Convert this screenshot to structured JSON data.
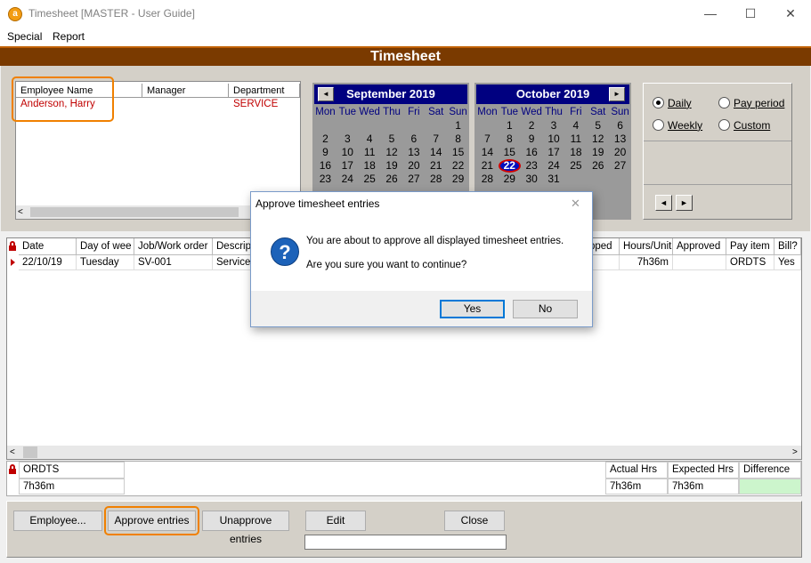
{
  "window": {
    "title": "Timesheet [MASTER - User Guide]",
    "app_icon_letter": "a",
    "minimize": "—",
    "maximize": "☐",
    "close": "✕"
  },
  "menu": [
    "Special",
    "Report"
  ],
  "banner_title": "Timesheet",
  "employee_list": {
    "columns": [
      "Employee Name",
      "Manager",
      "Department"
    ],
    "rows": [
      {
        "name": "Anderson, Harry",
        "manager": "",
        "department": "SERVICE"
      }
    ]
  },
  "calendars": [
    {
      "title": "September 2019",
      "nav": "◄",
      "weekdays": [
        "Mon",
        "Tue",
        "Wed",
        "Thu",
        "Fri",
        "Sat",
        "Sun"
      ],
      "weeks": [
        [
          "",
          "",
          "",
          "",
          "",
          "",
          "1"
        ],
        [
          "2",
          "3",
          "4",
          "5",
          "6",
          "7",
          "8"
        ],
        [
          "9",
          "10",
          "11",
          "12",
          "13",
          "14",
          "15"
        ],
        [
          "16",
          "17",
          "18",
          "19",
          "20",
          "21",
          "22"
        ],
        [
          "23",
          "24",
          "25",
          "26",
          "27",
          "28",
          "29"
        ]
      ]
    },
    {
      "title": "October 2019",
      "nav": "►",
      "weekdays": [
        "Mon",
        "Tue",
        "Wed",
        "Thu",
        "Fri",
        "Sat",
        "Sun"
      ],
      "weeks": [
        [
          "",
          "1",
          "2",
          "3",
          "4",
          "5",
          "6"
        ],
        [
          "7",
          "8",
          "9",
          "10",
          "11",
          "12",
          "13"
        ],
        [
          "14",
          "15",
          "16",
          "17",
          "18",
          "19",
          "20"
        ],
        [
          "21",
          "22",
          "23",
          "24",
          "25",
          "26",
          "27"
        ],
        [
          "28",
          "29",
          "30",
          "31",
          "",
          "",
          ""
        ]
      ],
      "today": "22"
    }
  ],
  "period_options": {
    "daily": "Daily",
    "pay_period": "Pay period",
    "weekly": "Weekly",
    "custom": "Custom",
    "selected": "Daily",
    "prev": "◄",
    "next": "►"
  },
  "grid": {
    "columns": [
      "Date",
      "Day of wee",
      "Job/Work order",
      "Descript",
      "pped",
      "Hours/Unit",
      "Approved",
      "Pay item",
      "Bill?"
    ],
    "rows": [
      [
        "22/10/19",
        "Tuesday",
        "SV-001",
        "Service",
        "",
        "7h36m",
        "",
        "ORDTS",
        "Yes"
      ]
    ]
  },
  "summary": {
    "pay_item": "ORDTS",
    "pay_item_total": "7h36m",
    "actual_label": "Actual Hrs",
    "actual_value": "7h36m",
    "expected_label": "Expected Hrs",
    "expected_value": "7h36m",
    "difference_label": "Difference",
    "difference_value": ""
  },
  "buttons": {
    "employee": "Employee...",
    "approve": "Approve entries",
    "unapprove": "Unapprove entries",
    "edit": "Edit",
    "close": "Close"
  },
  "dialog": {
    "title": "Approve timesheet entries",
    "close": "✕",
    "line1": "You are about to approve all displayed timesheet entries.",
    "line2": "Are you sure you want to continue?",
    "icon": "?",
    "yes": "Yes",
    "no": "No"
  },
  "colors": {
    "banner": "#7a3a00",
    "calendar_header": "#000080",
    "highlight": "#f08000",
    "employee_text": "#c00000",
    "difference_fill": "#ccf5cc"
  }
}
